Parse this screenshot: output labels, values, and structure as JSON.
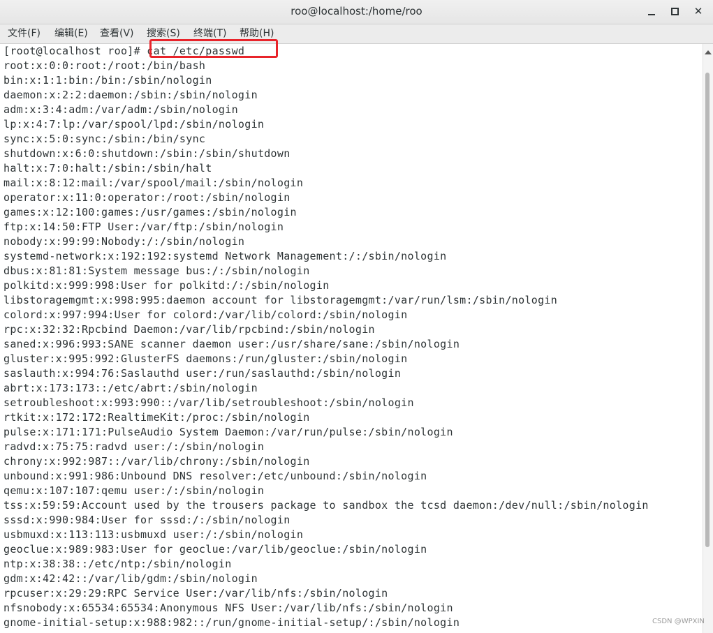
{
  "window": {
    "title": "roo@localhost:/home/roo",
    "minimize_label": "",
    "maximize_label": "",
    "close_label": "✕"
  },
  "menu": {
    "file": "文件(F)",
    "edit": "编辑(E)",
    "view": "查看(V)",
    "search": "搜索(S)",
    "terminal": "终端(T)",
    "help": "帮助(H)"
  },
  "terminal": {
    "prompt": "[root@localhost roo]# ",
    "command": "cat /etc/passwd",
    "highlight_color": "#e8242b",
    "lines": [
      "root:x:0:0:root:/root:/bin/bash",
      "bin:x:1:1:bin:/bin:/sbin/nologin",
      "daemon:x:2:2:daemon:/sbin:/sbin/nologin",
      "adm:x:3:4:adm:/var/adm:/sbin/nologin",
      "lp:x:4:7:lp:/var/spool/lpd:/sbin/nologin",
      "sync:x:5:0:sync:/sbin:/bin/sync",
      "shutdown:x:6:0:shutdown:/sbin:/sbin/shutdown",
      "halt:x:7:0:halt:/sbin:/sbin/halt",
      "mail:x:8:12:mail:/var/spool/mail:/sbin/nologin",
      "operator:x:11:0:operator:/root:/sbin/nologin",
      "games:x:12:100:games:/usr/games:/sbin/nologin",
      "ftp:x:14:50:FTP User:/var/ftp:/sbin/nologin",
      "nobody:x:99:99:Nobody:/:/sbin/nologin",
      "systemd-network:x:192:192:systemd Network Management:/:/sbin/nologin",
      "dbus:x:81:81:System message bus:/:/sbin/nologin",
      "polkitd:x:999:998:User for polkitd:/:/sbin/nologin",
      "libstoragemgmt:x:998:995:daemon account for libstoragemgmt:/var/run/lsm:/sbin/nologin",
      "colord:x:997:994:User for colord:/var/lib/colord:/sbin/nologin",
      "rpc:x:32:32:Rpcbind Daemon:/var/lib/rpcbind:/sbin/nologin",
      "saned:x:996:993:SANE scanner daemon user:/usr/share/sane:/sbin/nologin",
      "gluster:x:995:992:GlusterFS daemons:/run/gluster:/sbin/nologin",
      "saslauth:x:994:76:Saslauthd user:/run/saslauthd:/sbin/nologin",
      "abrt:x:173:173::/etc/abrt:/sbin/nologin",
      "setroubleshoot:x:993:990::/var/lib/setroubleshoot:/sbin/nologin",
      "rtkit:x:172:172:RealtimeKit:/proc:/sbin/nologin",
      "pulse:x:171:171:PulseAudio System Daemon:/var/run/pulse:/sbin/nologin",
      "radvd:x:75:75:radvd user:/:/sbin/nologin",
      "chrony:x:992:987::/var/lib/chrony:/sbin/nologin",
      "unbound:x:991:986:Unbound DNS resolver:/etc/unbound:/sbin/nologin",
      "qemu:x:107:107:qemu user:/:/sbin/nologin",
      "tss:x:59:59:Account used by the trousers package to sandbox the tcsd daemon:/dev/null:/sbin/nologin",
      "sssd:x:990:984:User for sssd:/:/sbin/nologin",
      "usbmuxd:x:113:113:usbmuxd user:/:/sbin/nologin",
      "geoclue:x:989:983:User for geoclue:/var/lib/geoclue:/sbin/nologin",
      "ntp:x:38:38::/etc/ntp:/sbin/nologin",
      "gdm:x:42:42::/var/lib/gdm:/sbin/nologin",
      "rpcuser:x:29:29:RPC Service User:/var/lib/nfs:/sbin/nologin",
      "nfsnobody:x:65534:65534:Anonymous NFS User:/var/lib/nfs:/sbin/nologin",
      "gnome-initial-setup:x:988:982::/run/gnome-initial-setup/:/sbin/nologin"
    ]
  },
  "watermark": "CSDN @WPXIN"
}
